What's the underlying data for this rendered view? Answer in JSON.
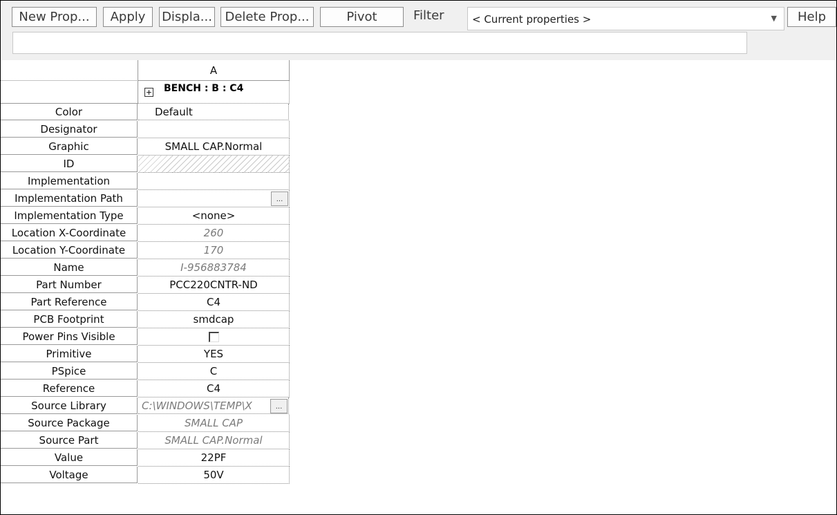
{
  "toolbar": {
    "new_prop": "New Prop...",
    "apply": "Apply",
    "display": "Displa...",
    "delete_prop": "Delete Prop...",
    "pivot": "Pivot",
    "filter_label": "Filter",
    "filter_value": "< Current properties >",
    "help": "Help",
    "command_value": ""
  },
  "grid": {
    "column_header": "A",
    "object_header": "BENCH : B : C4",
    "expand_icon": "plus-box-icon",
    "rows": [
      {
        "label": "Color",
        "value": "Default"
      },
      {
        "label": "Designator",
        "value": ""
      },
      {
        "label": "Graphic",
        "value": "SMALL CAP.Normal"
      },
      {
        "label": "ID",
        "value": ""
      },
      {
        "label": "Implementation",
        "value": ""
      },
      {
        "label": "Implementation Path",
        "value": ""
      },
      {
        "label": "Implementation Type",
        "value": "<none>"
      },
      {
        "label": "Location X-Coordinate",
        "value": "260"
      },
      {
        "label": "Location Y-Coordinate",
        "value": "170"
      },
      {
        "label": "Name",
        "value": "I-956883784"
      },
      {
        "label": "Part Number",
        "value": "PCC220CNTR-ND"
      },
      {
        "label": "Part Reference",
        "value": "C4"
      },
      {
        "label": "PCB Footprint",
        "value": "smdcap"
      },
      {
        "label": "Power Pins Visible",
        "value": false
      },
      {
        "label": "Primitive",
        "value": "YES"
      },
      {
        "label": "PSpice",
        "value": "C"
      },
      {
        "label": "Reference",
        "value": "C4"
      },
      {
        "label": "Source Library",
        "value": "C:\\WINDOWS\\TEMP\\X"
      },
      {
        "label": "Source Package",
        "value": "SMALL CAP"
      },
      {
        "label": "Source Part",
        "value": "SMALL CAP.Normal"
      },
      {
        "label": "Value",
        "value": "22PF"
      },
      {
        "label": "Voltage",
        "value": "50V"
      }
    ],
    "browse_button_label": "..."
  }
}
